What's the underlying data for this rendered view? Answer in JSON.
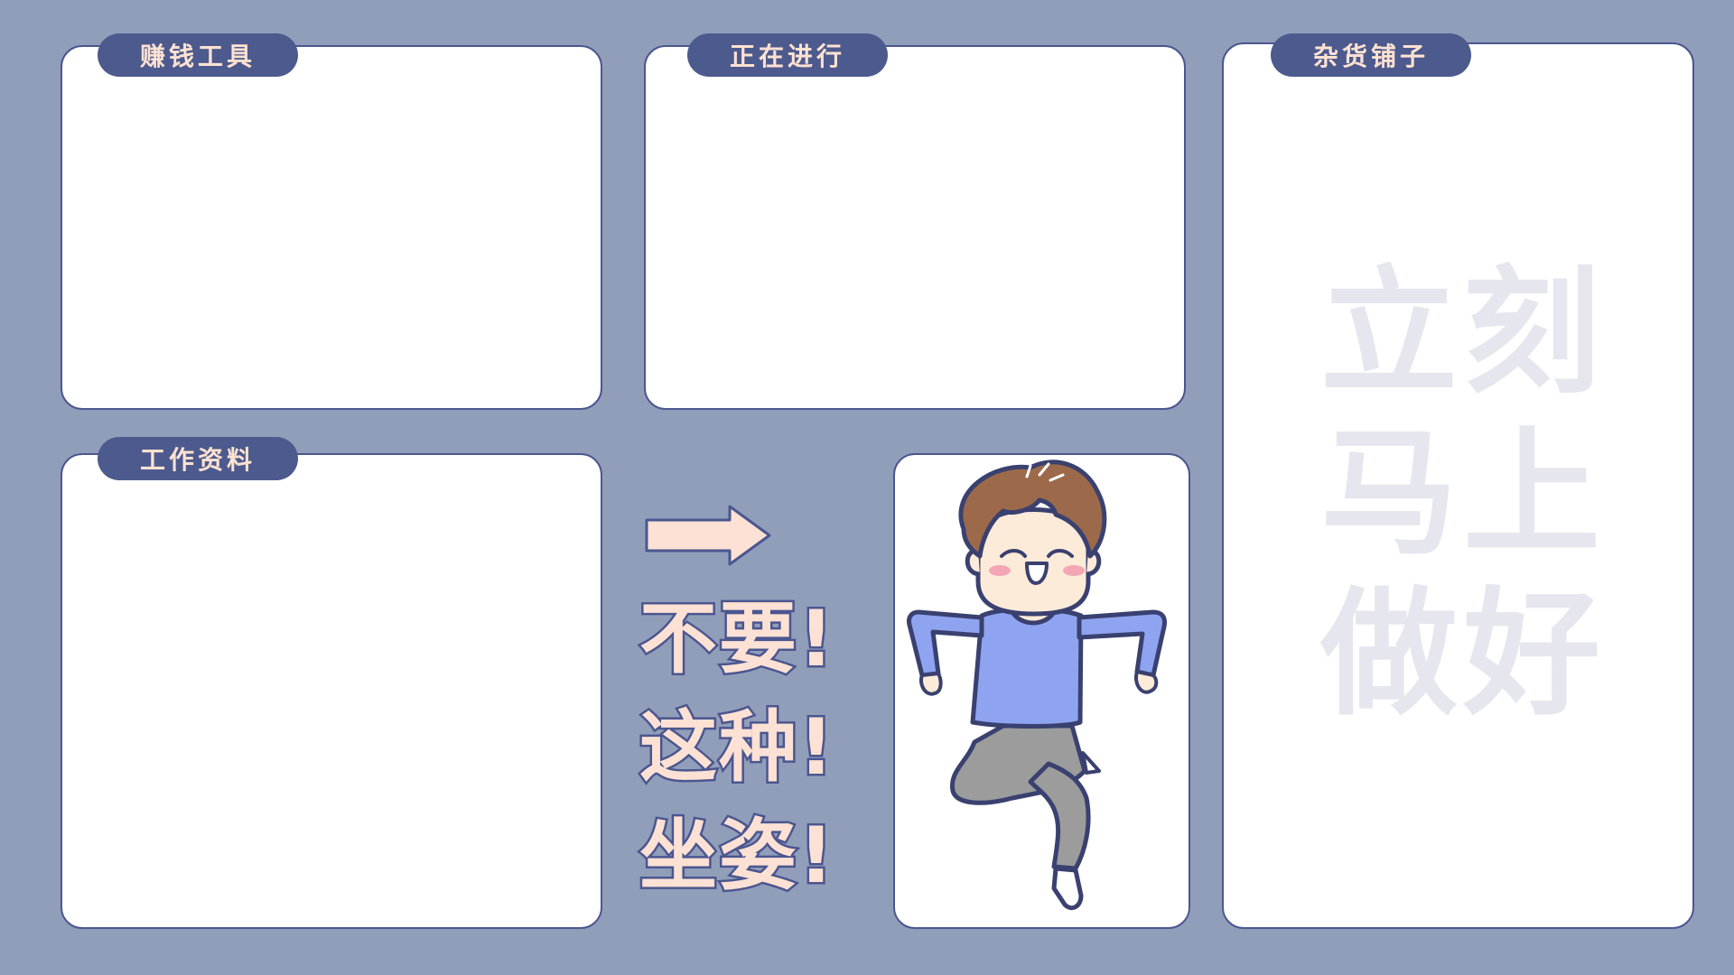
{
  "panels": {
    "earn_tools": {
      "label": "赚钱工具"
    },
    "in_progress": {
      "label": "正在进行"
    },
    "misc_shop": {
      "label": "杂货铺子"
    },
    "work_materials": {
      "label": "工作资料"
    }
  },
  "watermark": {
    "lines": [
      "立刻",
      "马上",
      "做好"
    ]
  },
  "slogan": {
    "lines": [
      "不要!",
      "这种!",
      "坐姿!"
    ]
  },
  "colors": {
    "background": "#919eba",
    "panel_border": "#4b5690",
    "tag_bg": "#4d5a8e",
    "tag_text": "#ffe2d2",
    "slogan_fill": "#fde1d4",
    "watermark_text": "#e6e7ee"
  },
  "icons": {
    "arrow": "arrow-right-icon",
    "character": "cartoon-boy-illustration"
  }
}
